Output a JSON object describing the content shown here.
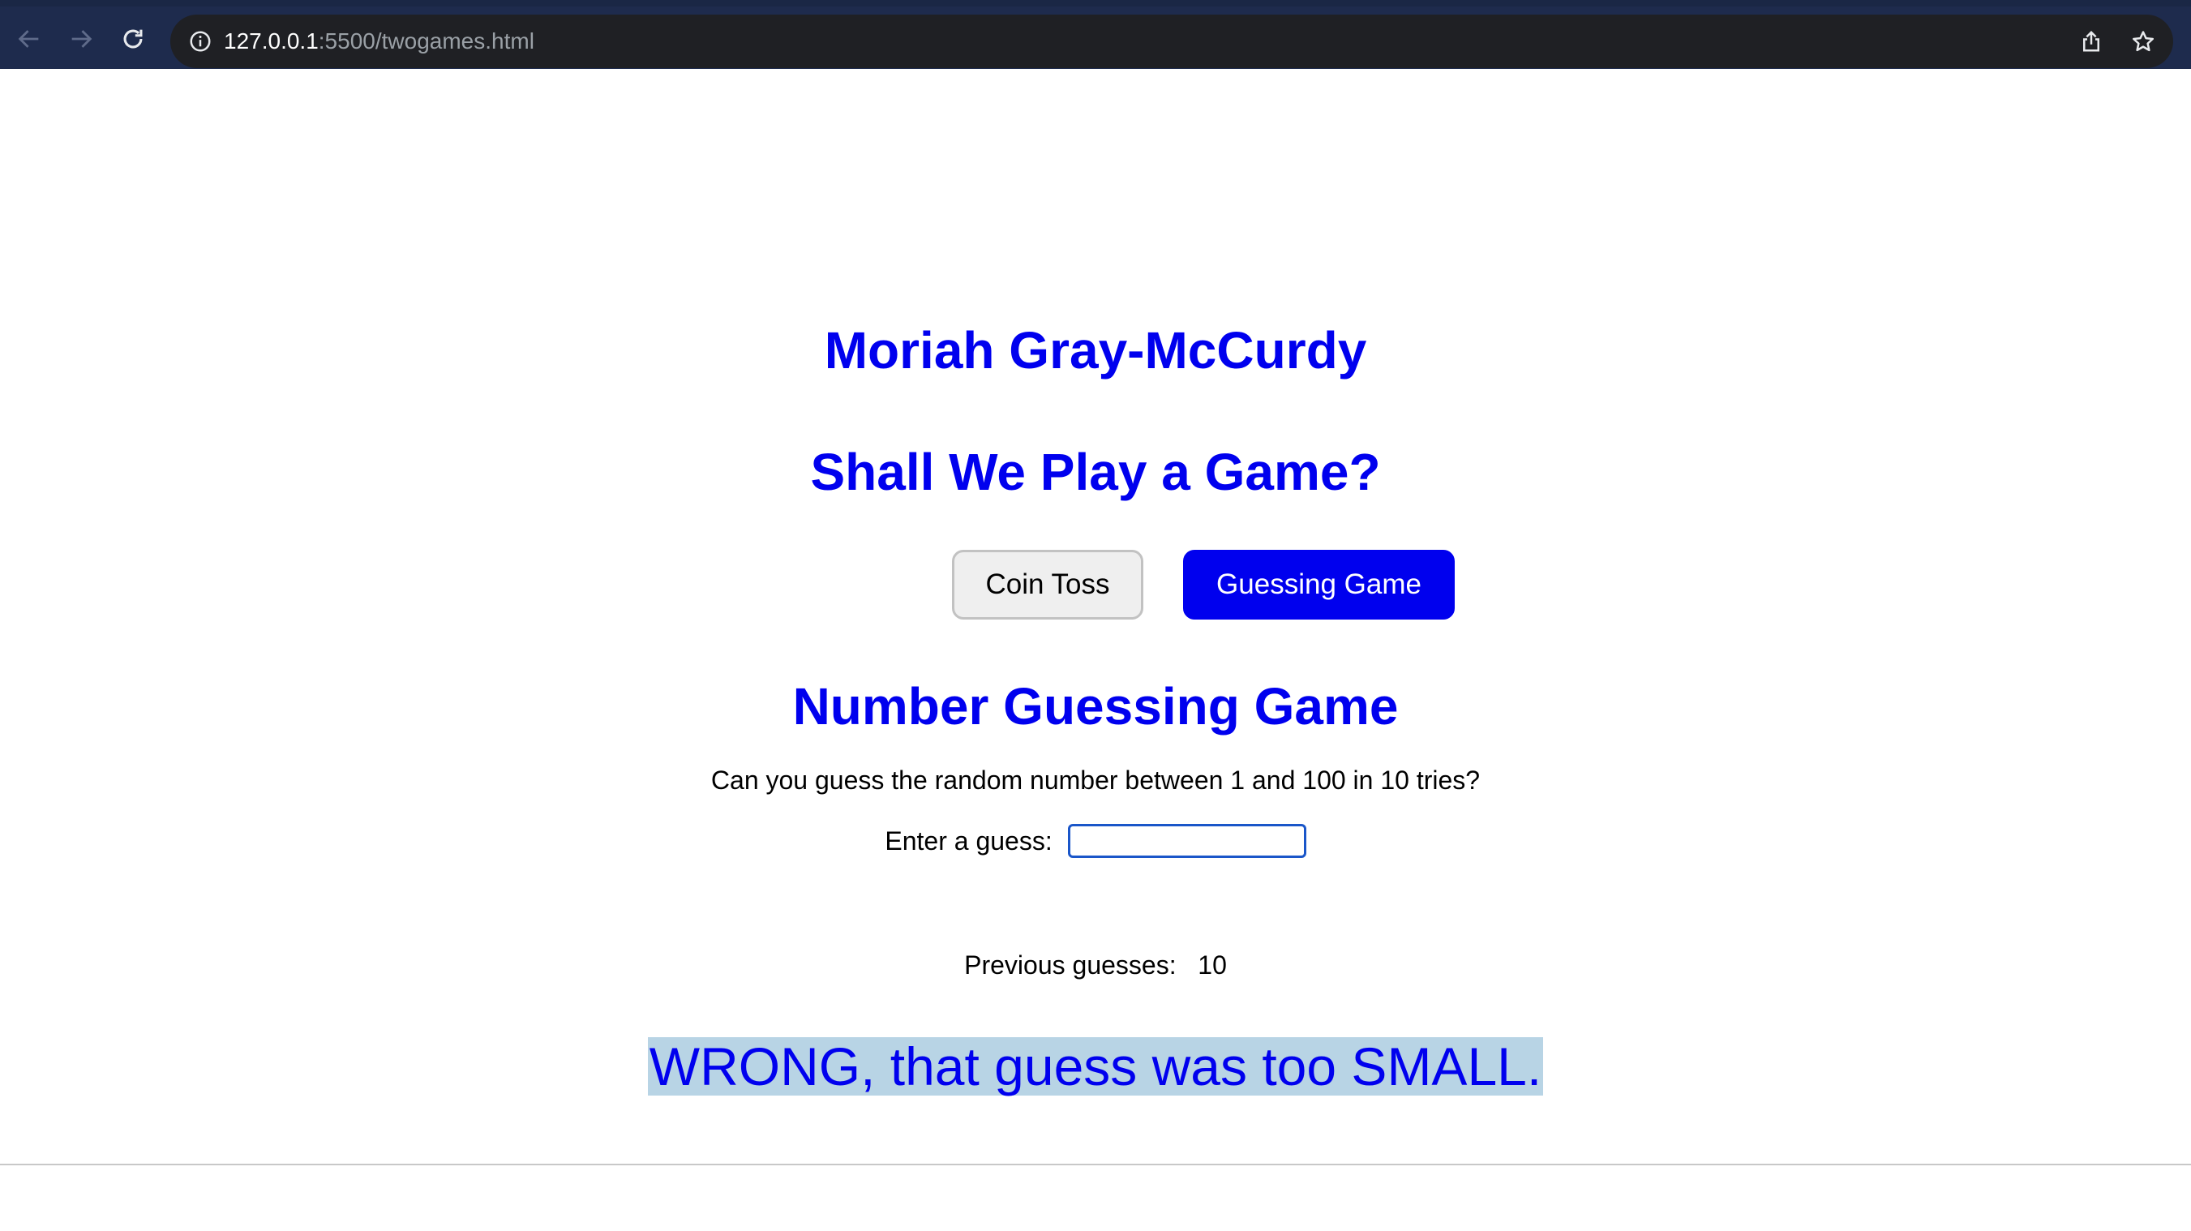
{
  "browser": {
    "url_host": "127.0.0.1",
    "url_path": ":5500/twogames.html",
    "icons": {
      "back": "arrow-left-icon",
      "forward": "arrow-right-icon",
      "reload": "reload-icon",
      "site_info": "info-icon",
      "share": "share-icon",
      "bookmark": "star-icon"
    }
  },
  "page": {
    "author_name": "Moriah Gray-McCurdy",
    "heading": "Shall We Play a Game?",
    "buttons": {
      "coin_toss": "Coin Toss",
      "guessing_game": "Guessing Game"
    },
    "game": {
      "title": "Number Guessing Game",
      "instructions": "Can you guess the random number between 1 and 100 in 10 tries?",
      "input_label": "Enter a guess:",
      "input_value": "",
      "previous_label": "Previous guesses:",
      "previous_values": "10",
      "result_message": "WRONG, that guess was too SMALL."
    }
  },
  "colors": {
    "accent": "#0000ee",
    "highlight": "#b8d4e5",
    "toolbar": "#1e2b4d",
    "omnibox": "#1f2024"
  }
}
